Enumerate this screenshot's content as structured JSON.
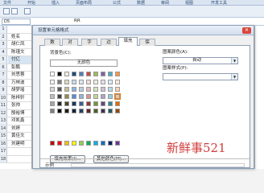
{
  "ribbon": {
    "tabs": [
      "文件",
      "开始",
      "插入",
      "页面布局",
      "公式",
      "数据",
      "审阅",
      "视图",
      "开发工具"
    ]
  },
  "formula_bar": {
    "name_box": "D5",
    "content": "RR"
  },
  "sheet": {
    "rows": [
      {
        "num": "1",
        "value": ""
      },
      {
        "num": "2",
        "value": "姓名"
      },
      {
        "num": "3",
        "value": "胡仁凤"
      },
      {
        "num": "4",
        "value": "陈瑾文"
      },
      {
        "num": "5",
        "value": "付亿"
      },
      {
        "num": "6",
        "value": "彭鹏"
      },
      {
        "num": "7",
        "value": "刘思蓉"
      },
      {
        "num": "8",
        "value": "万林波"
      },
      {
        "num": "9",
        "value": "胡梦瑶"
      },
      {
        "num": "10",
        "value": "陈梓轩"
      },
      {
        "num": "11",
        "value": "张帅"
      },
      {
        "num": "12",
        "value": "殷裕博"
      },
      {
        "num": "13",
        "value": "邓凯鑫"
      },
      {
        "num": "14",
        "value": "刘婷"
      },
      {
        "num": "15",
        "value": "黄佳文"
      },
      {
        "num": "16",
        "value": "刘建明"
      },
      {
        "num": "17",
        "value": ""
      },
      {
        "num": "18",
        "value": ""
      }
    ]
  },
  "dialog": {
    "title": "设置单元格格式",
    "tabs": [
      "数字",
      "对齐",
      "字体",
      "边框",
      "填充",
      "保护"
    ],
    "active_tab": "填充",
    "background_color_label": "背景色(C):",
    "no_color_label": "无颜色",
    "fill_effects_label": "填充效果(I)...",
    "more_colors_label": "其他颜色(M)...",
    "pattern_color_label": "图案颜色(A):",
    "pattern_color_value": "自动",
    "pattern_style_label": "图案样式(P):",
    "pattern_style_value": "",
    "sample_label": "示例"
  },
  "palette": [
    [
      "#ffffff",
      "#000000",
      "#eeece1",
      "#1f497d",
      "#4f81bd",
      "#c0504d",
      "#9bbb59",
      "#8064a2",
      "#4bacc6",
      "#f79646"
    ],
    [
      "#f2f2f2",
      "#7f7f7f",
      "#ddd9c3",
      "#c6d9f0",
      "#dbe5f1",
      "#f2dcdb",
      "#ebf1dd",
      "#e5e0ec",
      "#dbeef3",
      "#fdeada"
    ],
    [
      "#d8d8d8",
      "#595959",
      "#c4bd97",
      "#8db3e2",
      "#b8cce4",
      "#e5b9b7",
      "#d7e3bc",
      "#ccc1d9",
      "#b7dde8",
      "#fbd5b5"
    ],
    [
      "#bfbfbf",
      "#3f3f3f",
      "#938953",
      "#548dd4",
      "#95b3d7",
      "#d99694",
      "#c3d69b",
      "#b2a2c7",
      "#92cddc",
      "#fac08f"
    ],
    [
      "#a5a5a5",
      "#262626",
      "#494429",
      "#17365d",
      "#366092",
      "#953734",
      "#76923c",
      "#5f497a",
      "#31859b",
      "#e36c09"
    ],
    [
      "#7f7f7f",
      "#0c0c0c",
      "#1d1b10",
      "#0f243e",
      "#244061",
      "#632423",
      "#4f6128",
      "#3f3151",
      "#205867",
      "#974806"
    ]
  ],
  "standard_colors": [
    "#c00000",
    "#ff0000",
    "#ffc000",
    "#ffff00",
    "#92d050",
    "#00b050",
    "#00b0f0",
    "#0070c0",
    "#002060",
    "#7030a0"
  ],
  "watermark": "新鲜事521"
}
